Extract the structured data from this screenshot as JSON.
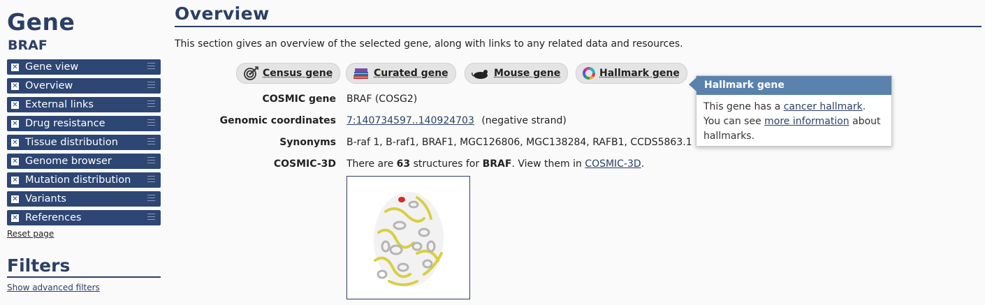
{
  "sidebar": {
    "title": "Gene",
    "gene": "BRAF",
    "items": [
      {
        "label": "Gene view"
      },
      {
        "label": "Overview"
      },
      {
        "label": "External links"
      },
      {
        "label": "Drug resistance"
      },
      {
        "label": "Tissue distribution"
      },
      {
        "label": "Genome browser"
      },
      {
        "label": "Mutation distribution"
      },
      {
        "label": "Variants"
      },
      {
        "label": "References"
      }
    ],
    "reset": "Reset page",
    "filters_title": "Filters",
    "advanced_filters": "Show advanced filters"
  },
  "main": {
    "title": "Overview",
    "intro": "This section gives an overview of the selected gene, along with links to any related data and resources.",
    "badges": {
      "census": "Census gene",
      "curated": "Curated gene",
      "mouse": "Mouse gene",
      "hallmark": "Hallmark gene"
    },
    "rows": {
      "cosmic_gene": {
        "label": "COSMIC gene",
        "value": "BRAF (COSG2)"
      },
      "coords": {
        "label": "Genomic coordinates",
        "link": "7:140734597..140924703",
        "suffix": "(negative strand)"
      },
      "synonyms": {
        "label": "Synonyms",
        "value": "B-raf 1, B-raf1, BRAF1, MGC126806, MGC138284, RAFB1, CCDS5863.1"
      },
      "cosmic3d": {
        "label": "COSMIC-3D",
        "pre": "There are",
        "count": "63",
        "mid": "structures for",
        "gene": "BRAF",
        "post": ". View them in",
        "link": "COSMIC-3D",
        "end": "."
      }
    }
  },
  "tooltip": {
    "title": "Hallmark gene",
    "t1": "This gene has a",
    "l1": "cancer hallmark",
    "t2": ".",
    "t3": "You can see",
    "l2": "more information",
    "t4": "about hallmarks."
  }
}
